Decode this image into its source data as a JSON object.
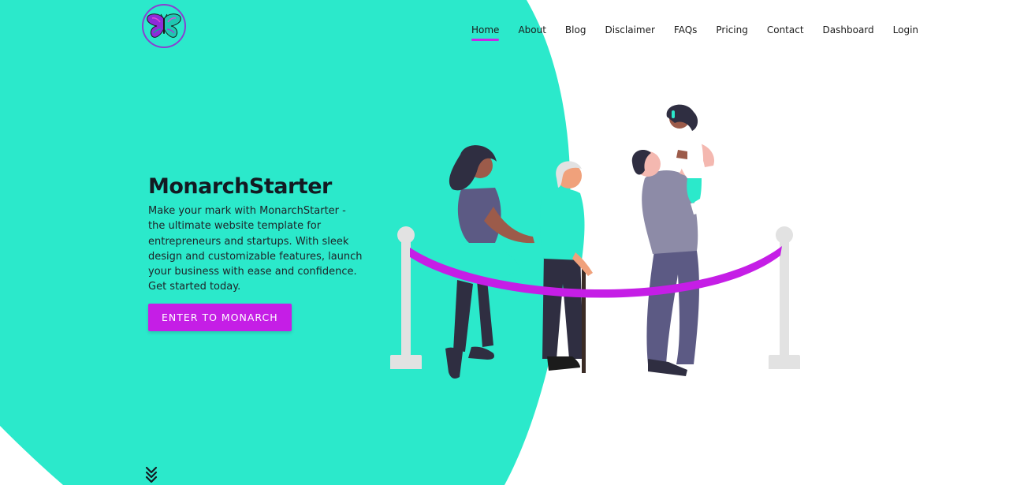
{
  "colors": {
    "accent_teal": "#2be9cb",
    "accent_purple": "#c51ee6",
    "text_dark": "#131a22"
  },
  "logo": {
    "icon": "butterfly-icon"
  },
  "nav": {
    "items": [
      {
        "label": "Home",
        "active": true
      },
      {
        "label": "About"
      },
      {
        "label": "Blog"
      },
      {
        "label": "Disclaimer"
      },
      {
        "label": "FAQs"
      },
      {
        "label": "Pricing"
      },
      {
        "label": "Contact"
      },
      {
        "label": "Dashboard"
      },
      {
        "label": "Login"
      }
    ]
  },
  "hero": {
    "title": "MonarchStarter",
    "description": "Make your mark with MonarchStarter - the ultimate website template for entrepreneurs and startups. With sleek design and customizable features, launch your business with ease and confidence. Get started today.",
    "cta_label": "ENTER TO MONARCH"
  },
  "illustration": {
    "icon": "people-at-rope-barrier-illustration"
  },
  "scroll": {
    "icon": "double-chevron-down-icon"
  }
}
